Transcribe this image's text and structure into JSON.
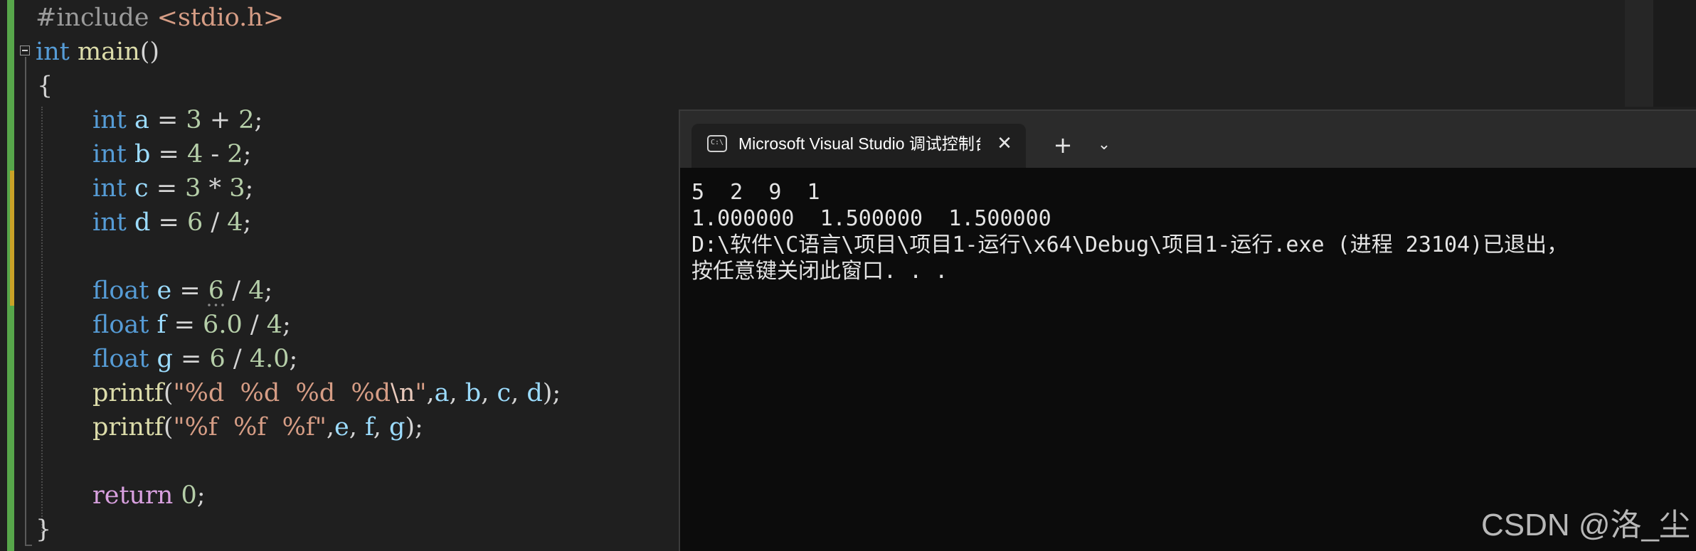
{
  "editor": {
    "include_directive": "#include",
    "include_file": "<stdio.h>",
    "line_main_type": "int",
    "line_main_name": "main",
    "line_main_parens": "()",
    "open_brace": "{",
    "close_brace": "}",
    "decl_a": {
      "type": "int",
      "name": "a",
      "eq": " = ",
      "v1": "3",
      "op": " + ",
      "v2": "2",
      "end": ";"
    },
    "decl_b": {
      "type": "int",
      "name": "b",
      "eq": " = ",
      "v1": "4",
      "op": " - ",
      "v2": "2",
      "end": ";"
    },
    "decl_c": {
      "type": "int",
      "name": "c",
      "eq": " = ",
      "v1": "3",
      "op": " * ",
      "v2": "3",
      "end": ";"
    },
    "decl_d": {
      "type": "int",
      "name": "d",
      "eq": " = ",
      "v1": "6",
      "op": " / ",
      "v2": "4",
      "end": ";"
    },
    "decl_e": {
      "type": "float",
      "name": "e",
      "eq": " = ",
      "v1": "6",
      "op": " / ",
      "v2": "4",
      "end": ";"
    },
    "decl_f": {
      "type": "float",
      "name": "f",
      "eq": " = ",
      "v1": "6.0",
      "op": " / ",
      "v2": "4",
      "end": ";"
    },
    "decl_g": {
      "type": "float",
      "name": "g",
      "eq": " = ",
      "v1": "6",
      "op": " / ",
      "v2": "4.0",
      "end": ";"
    },
    "printf1": {
      "fn": "printf",
      "open": "(",
      "fmt": "\"%d  %d  %d  %d",
      "esc": "\\n",
      "fmt_end": "\"",
      "args_sep1": ",",
      "a1": "a",
      "sep": ", ",
      "a2": "b",
      "a3": "c",
      "a4": "d",
      "close": ");"
    },
    "printf2": {
      "fn": "printf",
      "open": "(",
      "fmt": "\"%f  %f  %f\"",
      "args_sep1": ",",
      "a1": "e",
      "sep": ", ",
      "a2": "f",
      "a3": "g",
      "close": ");"
    },
    "return_kw": "return",
    "return_val": "0",
    "return_end": ";"
  },
  "terminal": {
    "tab_title": "Microsoft Visual Studio 调试控制台",
    "icon_text": "C:\\",
    "close_glyph": "✕",
    "new_tab_glyph": "+",
    "dropdown_glyph": "⌄",
    "output_lines": [
      "5  2  9  1",
      "1.000000  1.500000  1.500000",
      "D:\\软件\\C语言\\项目\\项目1-运行\\x64\\Debug\\项目1-运行.exe (进程 23104)已退出，",
      "按任意键关闭此窗口. . ."
    ]
  },
  "watermark": "CSDN @洛_尘",
  "colors": {
    "keyword": "#569cd6",
    "function": "#dcdcaa",
    "string": "#d69d85",
    "number": "#b5cea8",
    "variable": "#9cdcfe",
    "control_keyword": "#d8a0df",
    "editor_bg": "#1f1f1f",
    "terminal_bg": "#0c0c0c",
    "change_bar_green": "#57a64a",
    "change_bar_yellow": "#c9a227"
  }
}
